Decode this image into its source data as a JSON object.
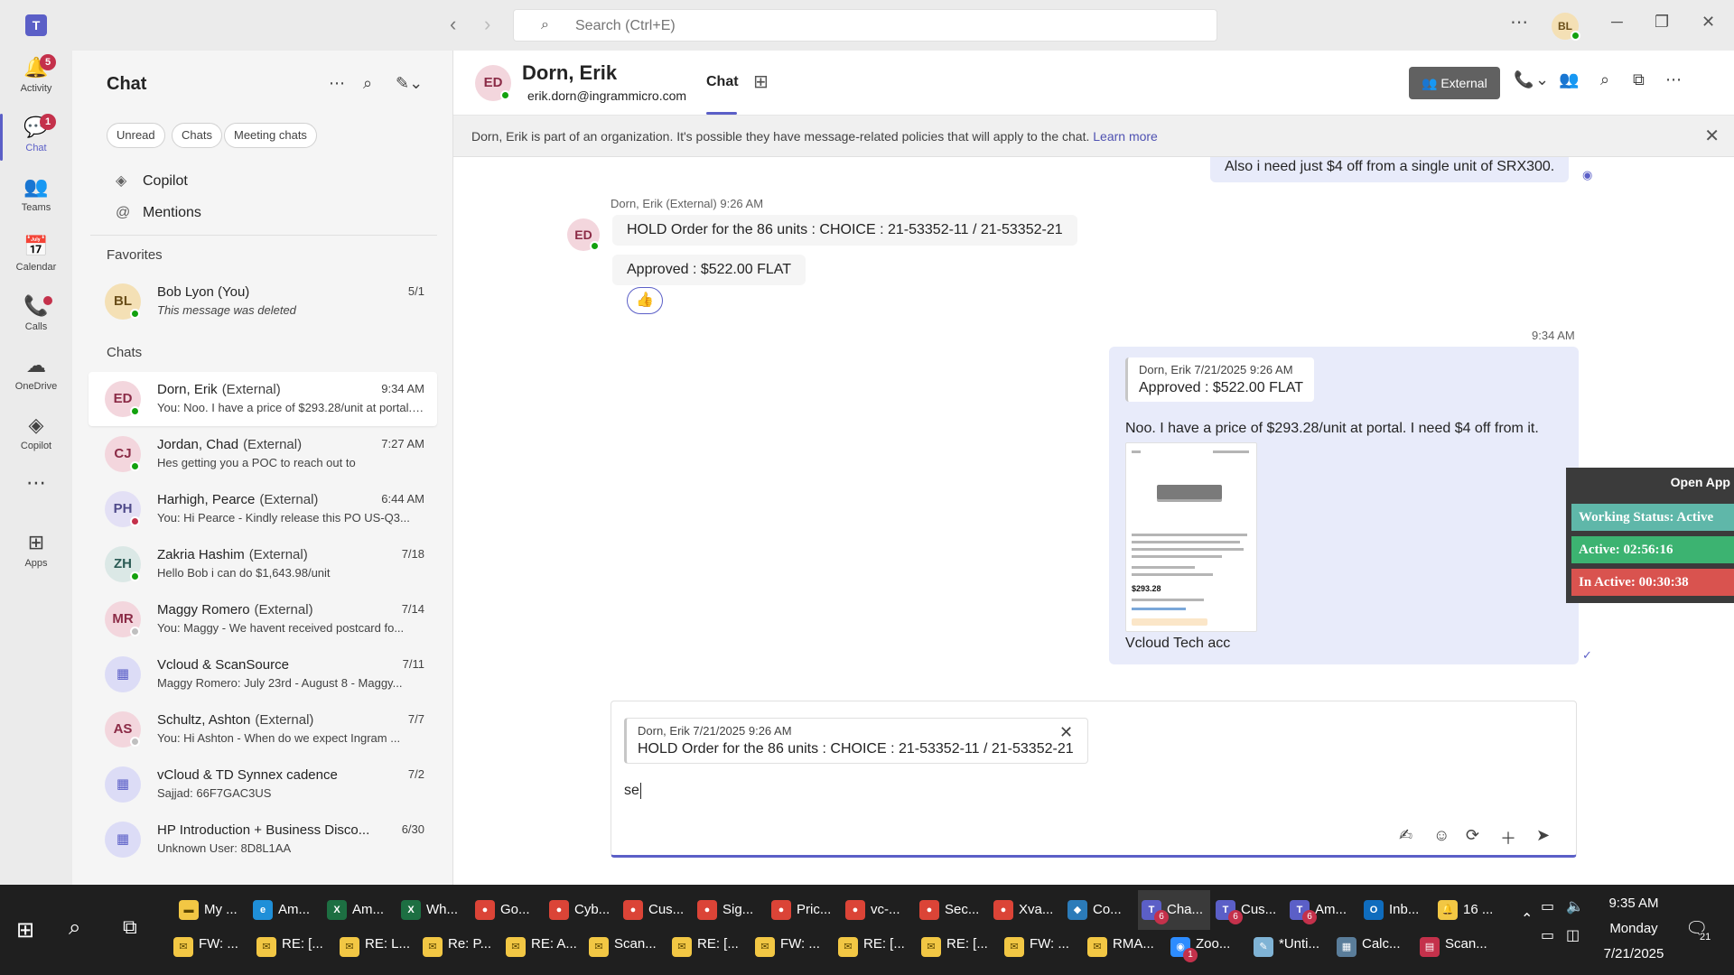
{
  "titlebar": {
    "search_placeholder": "Search (Ctrl+E)",
    "more": "⋯",
    "avatar_initials": "BL"
  },
  "rail": [
    {
      "label": "Activity",
      "icon": "bell-icon",
      "glyph": "🔔",
      "badge": "5"
    },
    {
      "label": "Chat",
      "icon": "chat-icon",
      "glyph": "💬",
      "badge": "1",
      "active": true
    },
    {
      "label": "Teams",
      "icon": "teams-icon",
      "glyph": "👥"
    },
    {
      "label": "Calendar",
      "icon": "calendar-icon",
      "glyph": "📅"
    },
    {
      "label": "Calls",
      "icon": "phone-icon",
      "glyph": "📞"
    },
    {
      "label": "OneDrive",
      "icon": "cloud-icon",
      "glyph": "☁"
    },
    {
      "label": "Copilot",
      "icon": "copilot-icon",
      "glyph": "◈"
    },
    {
      "label": "",
      "icon": "more-apps-icon",
      "glyph": "⋯"
    },
    {
      "label": "Apps",
      "icon": "apps-icon",
      "glyph": "⊞"
    }
  ],
  "chatpane": {
    "title": "Chat",
    "filters": [
      "Unread",
      "Chats",
      "Meeting chats"
    ],
    "copilot": "Copilot",
    "mentions": "Mentions",
    "favorites_header": "Favorites",
    "chats_header": "Chats",
    "favorites": [
      {
        "initials": "BL",
        "name": "Bob Lyon (You)",
        "time": "5/1",
        "preview": "This message was deleted",
        "avatar_bg": "#f4e0b5",
        "avatar_fg": "#6b4f1a",
        "presence": "#13a10e"
      }
    ],
    "chats": [
      {
        "initials": "ED",
        "name": "Dorn, Erik",
        "tag": "(External)",
        "time": "9:34 AM",
        "preview": "You: Noo.  I have a price of $293.28/unit at portal. I need $4 off from it.",
        "avatar_bg": "#f3d6dd",
        "avatar_fg": "#8b2b46",
        "presence": "#13a10e"
      },
      {
        "initials": "CJ",
        "name": "Jordan, Chad",
        "tag": "(External)",
        "time": "7:27 AM",
        "preview": "Hes getting you a POC to reach out to",
        "avatar_bg": "#f3d6dd",
        "avatar_fg": "#8b2b46",
        "presence": "#13a10e"
      },
      {
        "initials": "PH",
        "name": "Harhigh, Pearce",
        "tag": "(External)",
        "time": "6:44 AM",
        "preview": "You: Hi Pearce -  Kindly release this PO US-Q3...",
        "avatar_bg": "#e3e0f5",
        "avatar_fg": "#4f4a8a",
        "presence": "#c4314b"
      },
      {
        "initials": "ZH",
        "name": "Zakria Hashim",
        "tag": "(External)",
        "time": "7/18",
        "preview": "Hello Bob i can do $1,643.98/unit",
        "avatar_bg": "#dbe8e6",
        "avatar_fg": "#2b5b55",
        "presence": "#13a10e"
      },
      {
        "initials": "MR",
        "name": "Maggy Romero",
        "tag": "(External)",
        "time": "7/14",
        "preview": "You: Maggy - We havent received postcard fo...",
        "avatar_bg": "#f3d6dd",
        "avatar_fg": "#8b2b46",
        "presence": "#c0c0c0"
      },
      {
        "initials": "▦",
        "name": "Vcloud & ScanSource",
        "tag": "",
        "time": "7/11",
        "preview": "Maggy Romero: July 23rd - August 8 - Maggy...",
        "avatar_bg": "#dcdcf6",
        "avatar_fg": "#5b5fc7",
        "presence": ""
      },
      {
        "initials": "AS",
        "name": "Schultz, Ashton",
        "tag": "(External)",
        "time": "7/7",
        "preview": "You: Hi Ashton -  When do we expect Ingram ...",
        "avatar_bg": "#f3d6dd",
        "avatar_fg": "#8b2b46",
        "presence": "#c0c0c0"
      },
      {
        "initials": "▦",
        "name": "vCloud & TD Synnex cadence",
        "tag": "",
        "time": "7/2",
        "preview": "Sajjad: 66F7GAC3US",
        "avatar_bg": "#dcdcf6",
        "avatar_fg": "#5b5fc7",
        "presence": ""
      },
      {
        "initials": "▦",
        "name": "HP Introduction + Business Disco...",
        "tag": "",
        "time": "6/30",
        "preview": "Unknown User: 8D8L1AA",
        "avatar_bg": "#dcdcf6",
        "avatar_fg": "#5b5fc7",
        "presence": ""
      }
    ]
  },
  "header": {
    "initials": "ED",
    "name": "Dorn, Erik",
    "email": "erik.dorn@ingrammicro.com",
    "tab_chat": "Chat",
    "external": "External"
  },
  "banner": {
    "text": "Dorn, Erik is part of an organization. It's possible they have message-related policies that will apply to the chat.",
    "link": "Learn more"
  },
  "messages": {
    "out_top": "Also i need just $4 off from a single unit of SRX300.",
    "in_meta": "Dorn, Erik (External)   9:26 AM",
    "in_avatar": "ED",
    "in_1": "HOLD Order for the 86 units : CHOICE : 21-53352-11 / 21-53352-21",
    "in_2": "Approved : $522.00 FLAT",
    "reaction": "👍",
    "out_time": "9:34 AM",
    "out_quote_author": "Dorn, Erik   7/21/2025 9:26 AM",
    "out_quote_text": "Approved : $522.00 FLAT",
    "out_text": "Noo.  I have a price of $293.28/unit at portal. I need $4 off from it.",
    "product_price": "$293.28",
    "out_caption": "Vcloud Tech acc"
  },
  "status_widget": {
    "open": "Open App",
    "working": "Working Status: Active",
    "active": "Active: 02:56:16",
    "inactive": "In Active: 00:30:38",
    "colors": {
      "working": "#5fb7a9",
      "active": "#3cb371",
      "inactive": "#d9534f"
    }
  },
  "compose": {
    "quote_author": "Dorn, Erik   7/21/2025 9:26 AM",
    "quote_text": "HOLD Order for the 86 units : CHOICE : 21-53352-11 / 21-53352-21",
    "text": "se"
  },
  "taskbar": {
    "row1": [
      {
        "label": "My ...",
        "icon": "folder-icon",
        "bg": "#f2c744",
        "fg": "#5a4500",
        "glyph": "▬"
      },
      {
        "label": "Am...",
        "icon": "edge-icon",
        "bg": "#1f8fd8",
        "fg": "#fff",
        "glyph": "e"
      },
      {
        "label": "Am...",
        "icon": "excel-icon",
        "bg": "#1d6f42",
        "fg": "#fff",
        "glyph": "X"
      },
      {
        "label": "Wh...",
        "icon": "excel-icon",
        "bg": "#1d6f42",
        "fg": "#fff",
        "glyph": "X"
      },
      {
        "label": "Go...",
        "icon": "chrome-icon",
        "bg": "#db4437",
        "fg": "#fff",
        "glyph": "●"
      },
      {
        "label": "Cyb...",
        "icon": "chrome-icon",
        "bg": "#db4437",
        "fg": "#fff",
        "glyph": "●"
      },
      {
        "label": "Cus...",
        "icon": "chrome-icon",
        "bg": "#db4437",
        "fg": "#fff",
        "glyph": "●"
      },
      {
        "label": "Sig...",
        "icon": "chrome-icon",
        "bg": "#db4437",
        "fg": "#fff",
        "glyph": "●"
      },
      {
        "label": "Pric...",
        "icon": "chrome-icon",
        "bg": "#db4437",
        "fg": "#fff",
        "glyph": "●"
      },
      {
        "label": "vc-...",
        "icon": "chrome-icon",
        "bg": "#db4437",
        "fg": "#fff",
        "glyph": "●"
      },
      {
        "label": "Sec...",
        "icon": "chrome-icon",
        "bg": "#db4437",
        "fg": "#fff",
        "glyph": "●"
      },
      {
        "label": "Xva...",
        "icon": "chrome-icon",
        "bg": "#db4437",
        "fg": "#fff",
        "glyph": "●"
      },
      {
        "label": "Co...",
        "icon": "copilot-icon",
        "bg": "#2b7bb9",
        "fg": "#fff",
        "glyph": "◆"
      },
      {
        "label": "Cha...",
        "icon": "teams-icon",
        "bg": "#5b5fc7",
        "fg": "#fff",
        "glyph": "T",
        "badge": "6",
        "active": true
      },
      {
        "label": "Cus...",
        "icon": "teams-icon",
        "bg": "#5b5fc7",
        "fg": "#fff",
        "glyph": "T",
        "badge": "6"
      },
      {
        "label": "Am...",
        "icon": "teams-icon",
        "bg": "#5b5fc7",
        "fg": "#fff",
        "glyph": "T",
        "badge": "6"
      },
      {
        "label": "Inb...",
        "icon": "outlook-icon",
        "bg": "#0f6cbd",
        "fg": "#fff",
        "glyph": "O"
      },
      {
        "label": "16 ...",
        "icon": "bell-icon",
        "bg": "#f2c744",
        "fg": "#5a4500",
        "glyph": "🔔"
      }
    ],
    "row2": [
      {
        "label": "FW: ...",
        "icon": "mail-icon"
      },
      {
        "label": "RE: [...",
        "icon": "mail-icon"
      },
      {
        "label": "RE: L...",
        "icon": "mail-icon"
      },
      {
        "label": "Re: P...",
        "icon": "mail-icon"
      },
      {
        "label": "RE: A...",
        "icon": "mail-icon"
      },
      {
        "label": "Scan...",
        "icon": "mail-icon"
      },
      {
        "label": "RE: [...",
        "icon": "mail-icon"
      },
      {
        "label": "FW: ...",
        "icon": "mail-icon"
      },
      {
        "label": "RE: [...",
        "icon": "mail-icon"
      },
      {
        "label": "RE: [...",
        "icon": "mail-icon"
      },
      {
        "label": "FW: ...",
        "icon": "mail-icon"
      },
      {
        "label": "RMA...",
        "icon": "mail-icon"
      },
      {
        "label": "Zoo...",
        "icon": "zoom-icon",
        "badge": "1"
      },
      {
        "label": "*Unti...",
        "icon": "notepad-icon"
      },
      {
        "label": "Calc...",
        "icon": "calculator-icon"
      },
      {
        "label": "Scan...",
        "icon": "pdf-icon"
      }
    ],
    "time": "9:35 AM",
    "day": "Monday",
    "date": "7/21/2025",
    "notify_count": "21"
  }
}
